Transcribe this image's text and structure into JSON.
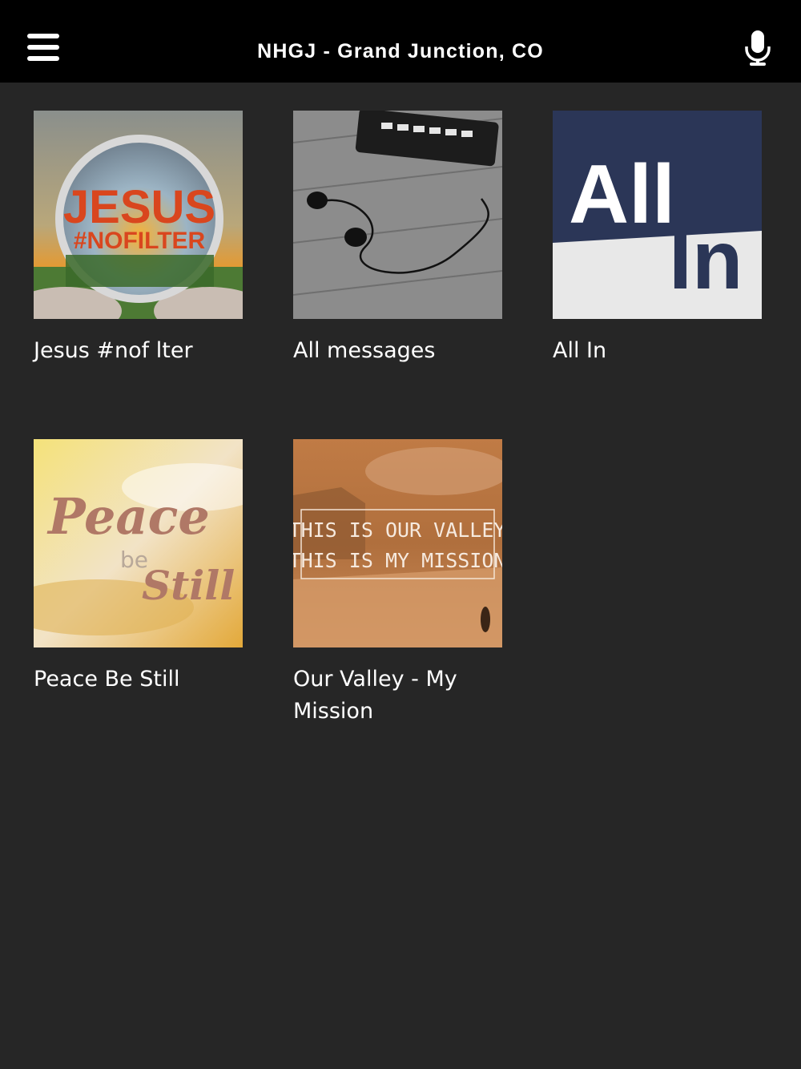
{
  "header": {
    "title": "NHGJ - Grand Junction, CO",
    "menu_icon": "hamburger-menu-icon",
    "mic_icon": "microphone-icon"
  },
  "tiles": [
    {
      "label": "Jesus #nof lter",
      "art": {
        "line1": "JESUS",
        "line2": "#NOFILTER"
      }
    },
    {
      "label": "All messages",
      "art": {}
    },
    {
      "label": "All In",
      "art": {
        "line1": "All",
        "line2": "In"
      }
    },
    {
      "label": "Peace Be Still",
      "art": {
        "line1": "Peace",
        "line2": "be",
        "line3": "Still"
      }
    },
    {
      "label": "Our Valley - My Mission",
      "label_lines": [
        "Our Valley - My",
        "Mission"
      ],
      "art": {
        "line1": "THIS IS OUR VALLEY",
        "line2": "THIS IS MY MISSION"
      }
    }
  ],
  "colors": {
    "background": "#262626",
    "topbar": "#000000",
    "text": "#ffffff"
  }
}
